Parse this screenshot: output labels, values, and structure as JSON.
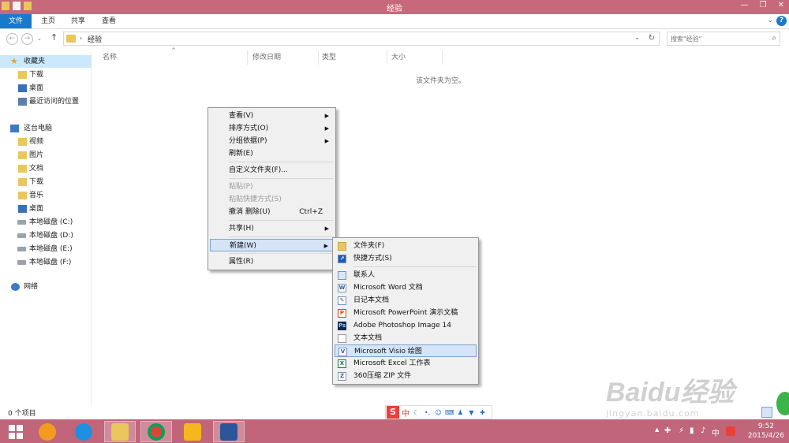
{
  "window": {
    "title": "经验"
  },
  "ribbon": {
    "tabs": [
      "文件",
      "主页",
      "共享",
      "查看"
    ],
    "help": "?"
  },
  "address": {
    "path": "经验",
    "search_placeholder": "搜索\"经验\""
  },
  "sidebar": {
    "favorites": {
      "label": "收藏夹",
      "items": [
        "下载",
        "桌面",
        "最近访问的位置"
      ]
    },
    "this_pc": {
      "label": "这台电脑",
      "items": [
        "视频",
        "图片",
        "文档",
        "下载",
        "音乐",
        "桌面",
        "本地磁盘 (C:)",
        "本地磁盘 (D:)",
        "本地磁盘 (E:)",
        "本地磁盘 (F:)"
      ]
    },
    "network": {
      "label": "网络"
    }
  },
  "columns": [
    "名称",
    "修改日期",
    "类型",
    "大小"
  ],
  "empty_text": "该文件夹为空。",
  "context_menu": {
    "items": [
      {
        "label": "查看(V)",
        "submenu": true
      },
      {
        "label": "排序方式(O)",
        "submenu": true
      },
      {
        "label": "分组依据(P)",
        "submenu": true
      },
      {
        "label": "刷新(E)"
      },
      {
        "label": "自定义文件夹(F)..."
      },
      {
        "label": "粘贴(P)",
        "disabled": true
      },
      {
        "label": "粘贴快捷方式(S)",
        "disabled": true
      },
      {
        "label": "撤消 删除(U)",
        "shortcut": "Ctrl+Z"
      },
      {
        "label": "共享(H)",
        "submenu": true
      },
      {
        "label": "新建(W)",
        "submenu": true,
        "highlighted": true
      },
      {
        "label": "属性(R)"
      }
    ]
  },
  "new_submenu": {
    "items": [
      {
        "label": "文件夹(F)",
        "icon": "folder-icon"
      },
      {
        "label": "快捷方式(S)",
        "icon": "shortcut-icon"
      },
      {
        "label": "联系人",
        "icon": "contact-icon"
      },
      {
        "label": "Microsoft Word 文档",
        "icon": "word-icon"
      },
      {
        "label": "日记本文档",
        "icon": "journal-icon"
      },
      {
        "label": "Microsoft PowerPoint 演示文稿",
        "icon": "powerpoint-icon"
      },
      {
        "label": "Adobe Photoshop Image 14",
        "icon": "photoshop-icon"
      },
      {
        "label": "文本文档",
        "icon": "text-document-icon"
      },
      {
        "label": "Microsoft Visio 绘图",
        "icon": "visio-icon",
        "highlighted": true
      },
      {
        "label": "Microsoft Excel 工作表",
        "icon": "excel-icon"
      },
      {
        "label": "360压缩 ZIP 文件",
        "icon": "zip-icon"
      }
    ]
  },
  "status": {
    "items_count": "0 个项目"
  },
  "ime": {
    "mode": "中"
  },
  "watermark": {
    "logo": "Baidu经验",
    "url": "jingyan.baidu.com"
  },
  "taskbar": {
    "tray_ime": "中",
    "time": "9:52",
    "date": "2015/4/26"
  },
  "colors": {
    "titlebar": "#c7697a",
    "taskbar": "#c0657a",
    "accent": "#1979ca"
  }
}
